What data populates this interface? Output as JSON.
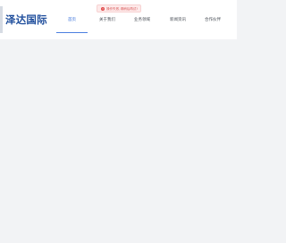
{
  "header": {
    "logo_text": "泽达国际"
  },
  "nav": {
    "items": [
      {
        "label": "首页",
        "active": true
      },
      {
        "label": "关于我们",
        "active": false
      },
      {
        "label": "业务领域",
        "active": false
      },
      {
        "label": "新闻资讯",
        "active": false
      },
      {
        "label": "合作伙伴",
        "active": false
      }
    ]
  },
  "toast": {
    "icon": "error-icon",
    "text": "操作失败,请稍后再试!",
    "color": "#e04848"
  },
  "colors": {
    "brand": "#1f4e9c",
    "accent": "#2f6ad8",
    "background": "#f2f3f5"
  }
}
